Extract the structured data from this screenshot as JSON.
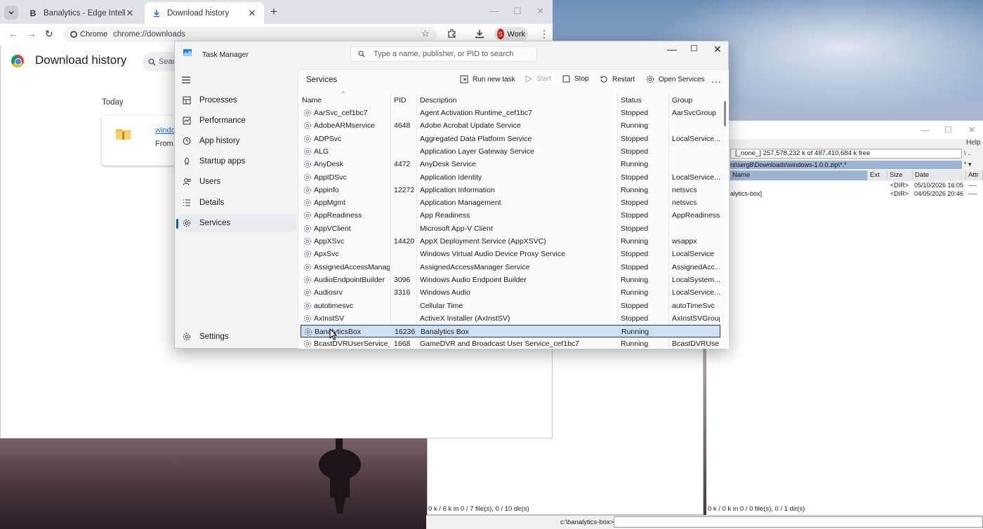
{
  "chrome": {
    "tabs": [
      {
        "title": "Banalytics - Edge Intelligence fo",
        "favicon": "B"
      },
      {
        "title": "Download history"
      }
    ],
    "omnibox": {
      "chip": "Chrome",
      "url": "chrome://downloads"
    },
    "profile": {
      "initial": "S",
      "label": "Work"
    },
    "page_title": "Download history",
    "search_placeholder": "Searc",
    "section": "Today",
    "download": {
      "file": "windo",
      "from": "From l"
    }
  },
  "task_manager": {
    "title": "Task Manager",
    "search_placeholder": "Type a name, publisher, or PID to search",
    "nav": [
      {
        "label": "Processes",
        "icon": "processes-icon"
      },
      {
        "label": "Performance",
        "icon": "performance-icon"
      },
      {
        "label": "App history",
        "icon": "history-icon"
      },
      {
        "label": "Startup apps",
        "icon": "startup-icon"
      },
      {
        "label": "Users",
        "icon": "users-icon"
      },
      {
        "label": "Details",
        "icon": "details-icon"
      },
      {
        "label": "Services",
        "icon": "services-icon"
      }
    ],
    "settings_label": "Settings",
    "section_title": "Services",
    "commands": {
      "run_new_task": "Run new task",
      "start": "Start",
      "stop": "Stop",
      "restart": "Restart",
      "open_services": "Open Services",
      "more": "..."
    },
    "columns": {
      "name": "Name",
      "pid": "PID",
      "description": "Description",
      "status": "Status",
      "group": "Group"
    },
    "rows": [
      {
        "name": "AarSvc_cef1bc7",
        "pid": "",
        "description": "Agent Activation Runtime_cef1bc7",
        "status": "Stopped",
        "group": "AarSvcGroup"
      },
      {
        "name": "AdobeARMservice",
        "pid": "4648",
        "description": "Adobe Acrobat Update Service",
        "status": "Running",
        "group": ""
      },
      {
        "name": "ADPSvc",
        "pid": "",
        "description": "Aggregated Data Platform Service",
        "status": "Stopped",
        "group": "LocalService..."
      },
      {
        "name": "ALG",
        "pid": "",
        "description": "Application Layer Gateway Service",
        "status": "Stopped",
        "group": ""
      },
      {
        "name": "AnyDesk",
        "pid": "4472",
        "description": "AnyDesk Service",
        "status": "Running",
        "group": ""
      },
      {
        "name": "AppIDSvc",
        "pid": "",
        "description": "Application Identity",
        "status": "Stopped",
        "group": "LocalService..."
      },
      {
        "name": "Appinfo",
        "pid": "12272",
        "description": "Application Information",
        "status": "Running",
        "group": "netsvcs"
      },
      {
        "name": "AppMgmt",
        "pid": "",
        "description": "Application Management",
        "status": "Stopped",
        "group": "netsvcs"
      },
      {
        "name": "AppReadiness",
        "pid": "",
        "description": "App Readiness",
        "status": "Stopped",
        "group": "AppReadiness"
      },
      {
        "name": "AppVClient",
        "pid": "",
        "description": "Microsoft App-V Client",
        "status": "Stopped",
        "group": ""
      },
      {
        "name": "AppXSvc",
        "pid": "14420",
        "description": "AppX Deployment Service (AppXSVC)",
        "status": "Running",
        "group": "wsappx"
      },
      {
        "name": "ApxSvc",
        "pid": "",
        "description": "Windows Virtual Audio Device Proxy Service",
        "status": "Stopped",
        "group": "LocalService"
      },
      {
        "name": "AssignedAccessManag...",
        "pid": "",
        "description": "AssignedAccessManager Service",
        "status": "Stopped",
        "group": "AssignedAcc..."
      },
      {
        "name": "AudioEndpointBuilder",
        "pid": "3096",
        "description": "Windows Audio Endpoint Builder",
        "status": "Running",
        "group": "LocalSystem..."
      },
      {
        "name": "Audiosrv",
        "pid": "3316",
        "description": "Windows Audio",
        "status": "Running",
        "group": "LocalService..."
      },
      {
        "name": "autotimesvc",
        "pid": "",
        "description": "Cellular Time",
        "status": "Stopped",
        "group": "autoTimeSvc"
      },
      {
        "name": "AxInstSV",
        "pid": "",
        "description": "ActiveX Installer (AxInstSV)",
        "status": "Stopped",
        "group": "AxInstSVGroup"
      },
      {
        "name": "BanalyticsBox",
        "pid": "16236",
        "description": "Banalytics Box",
        "status": "Running",
        "group": "",
        "selected": true
      },
      {
        "name": "BcastDVRUserService_c...",
        "pid": "1668",
        "description": "GameDVR and Broadcast User Service_cef1bc7",
        "status": "Running",
        "group": "BcastDVRUse..."
      }
    ]
  },
  "total_commander": {
    "help": "Help",
    "drive_info": "[_none_]  257,578,232 k of 487,410,684 k free",
    "drive_buttons": "\\  ..",
    "path": "rs\\serg8\\Downloads\\windows-1.0.0.zip\\*.*",
    "path_buttons": "*  ▾",
    "columns": {
      "name": "Name",
      "ext": "Ext",
      "size": "Size",
      "date": "Date",
      "attr": "Attr"
    },
    "rows": [
      {
        "name": "",
        "size": "<DIR>",
        "date": "05/10/2026 16:05",
        "attr": "----"
      },
      {
        "name": "alytics-box]",
        "size": "<DIR>",
        "date": "04/05/2026 20:46",
        "attr": "----"
      }
    ],
    "status_left": "0 k / 6 k in 0 / 7 file(s), 0 / 10 dir(s)",
    "status_right": "0 k / 0 k in 0 / 0 file(s), 0 / 1 dir(s)",
    "command_label": "c:\\banalytics-box>"
  }
}
